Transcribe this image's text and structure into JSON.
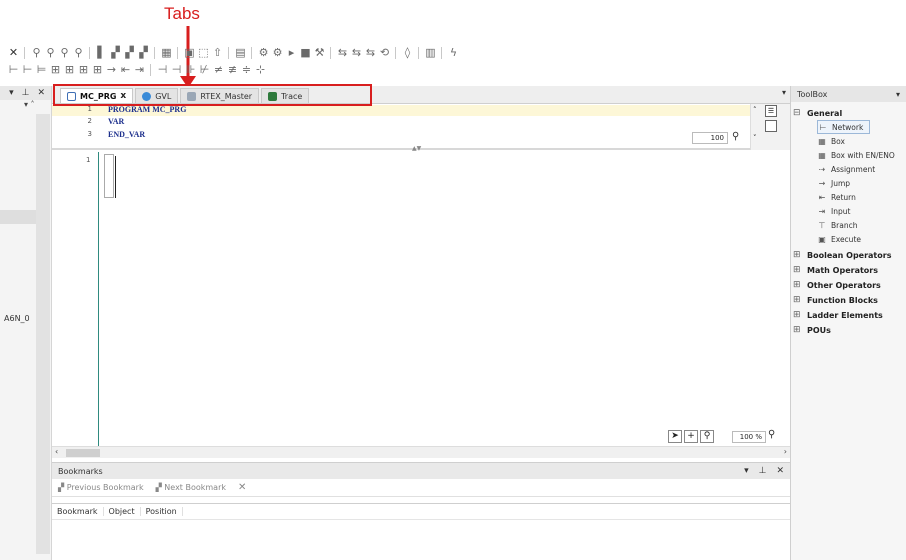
{
  "annotation": {
    "label": "Tabs"
  },
  "tabs": [
    {
      "label": "MC_PRG",
      "active": true,
      "icon": "program-icon"
    },
    {
      "label": "GVL",
      "active": false,
      "icon": "globe-icon"
    },
    {
      "label": "RTEX_Master",
      "active": false,
      "icon": "device-icon"
    },
    {
      "label": "Trace",
      "active": false,
      "icon": "trace-icon"
    }
  ],
  "tab_close": "x",
  "declaration": {
    "lines": [
      {
        "num": "1",
        "code": "PROGRAM MC_PRG"
      },
      {
        "num": "2",
        "code": "VAR"
      },
      {
        "num": "3",
        "code": "END_VAR"
      }
    ],
    "zoom": "100"
  },
  "implementation": {
    "line_num": "1",
    "zoom": "100 %"
  },
  "left_dock": {
    "item": "A6N_0"
  },
  "bookmarks": {
    "title": "Bookmarks",
    "previous": "Previous Bookmark",
    "next": "Next Bookmark",
    "columns": [
      "Bookmark",
      "Object",
      "Position"
    ]
  },
  "toolbox": {
    "title": "ToolBox",
    "general_label": "General",
    "general_items": [
      {
        "label": "Network",
        "icon": "network-icon",
        "selected": true
      },
      {
        "label": "Box",
        "icon": "box-icon"
      },
      {
        "label": "Box with EN/ENO",
        "icon": "box-en-icon"
      },
      {
        "label": "Assignment",
        "icon": "assignment-icon"
      },
      {
        "label": "Jump",
        "icon": "jump-icon"
      },
      {
        "label": "Return",
        "icon": "return-icon"
      },
      {
        "label": "Input",
        "icon": "input-icon"
      },
      {
        "label": "Branch",
        "icon": "branch-icon"
      },
      {
        "label": "Execute",
        "icon": "execute-icon"
      }
    ],
    "groups": [
      "Boolean Operators",
      "Math Operators",
      "Other Operators",
      "Function Blocks",
      "Ladder Elements",
      "POUs"
    ]
  },
  "colors": {
    "annotation": "#d81e1e",
    "keyword": "#1c2f8c",
    "gutter": "#2f8a7f",
    "decl_highlight": "#fdf7d7"
  }
}
